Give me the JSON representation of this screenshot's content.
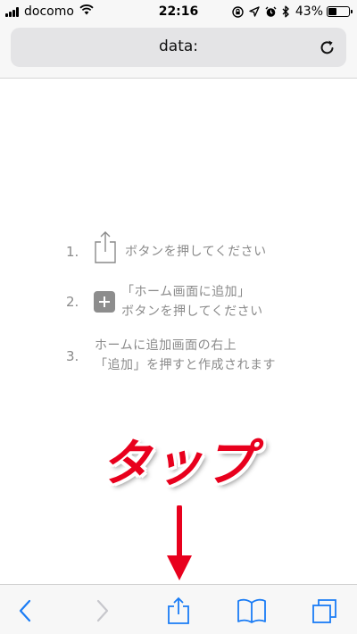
{
  "status_bar": {
    "carrier": "docomo",
    "time": "22:16",
    "battery_percent": "43%",
    "battery_level": 0.43,
    "icons": [
      "signal-icon",
      "wifi-icon",
      "screen-lock-icon",
      "location-arrow-icon",
      "alarm-icon",
      "bluetooth-icon",
      "battery-icon"
    ]
  },
  "address_bar": {
    "url_text": "data:",
    "reload_icon": "reload-icon"
  },
  "instructions": {
    "steps": [
      {
        "number": "1.",
        "icon": "share-icon",
        "text": "ボタンを押してください"
      },
      {
        "number": "2.",
        "icon": "plus-icon",
        "line1": "「ホーム画面に追加」",
        "line2": "ボタンを押してください"
      },
      {
        "number": "3.",
        "line1": "ホームに追加画面の右上",
        "line2": "「追加」を押すと作成されます"
      }
    ]
  },
  "annotation": {
    "text": "タップ",
    "color": "#e8001d",
    "arrow_icon": "down-arrow-icon"
  },
  "toolbar": {
    "accent_color": "#1a7cf5",
    "disabled_color": "#c7c7cc",
    "items": [
      "back-icon",
      "forward-icon",
      "share-icon",
      "bookmarks-icon",
      "tabs-icon"
    ]
  }
}
